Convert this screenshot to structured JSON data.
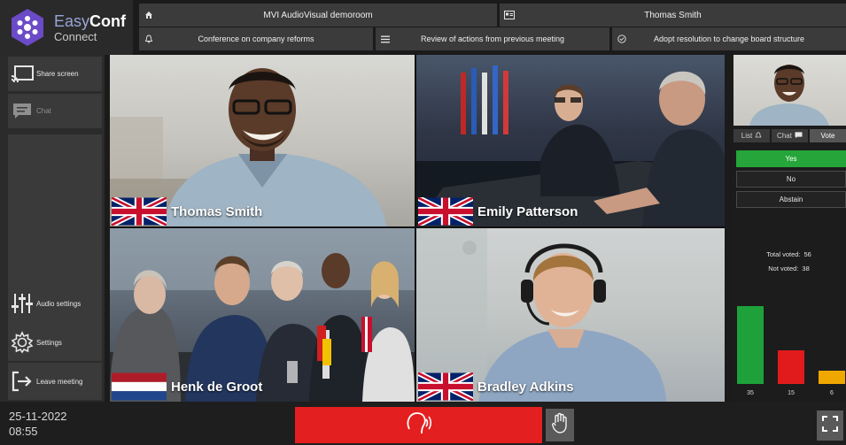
{
  "app": {
    "brand_easy": "Easy",
    "brand_conf": "Conf",
    "brand_sub": "Connect"
  },
  "header": {
    "room": "MVI AudioVisual demoroom",
    "user": "Thomas Smith",
    "agenda": [
      "Conference on company reforms",
      "Review of actions from previous meeting",
      "Adopt resolution to change board structure"
    ],
    "icons": [
      "home-icon",
      "id-card-icon",
      "bell-icon",
      "list-icon",
      "check-circle-icon"
    ]
  },
  "sidebar": {
    "share_screen": "Share screen",
    "chat": "Chat",
    "audio_settings": "Audio settings",
    "settings": "Settings",
    "leave_meeting": "Leave meeting"
  },
  "participants": [
    {
      "name": "Thomas Smith",
      "flag": "uk"
    },
    {
      "name": "Emily Patterson",
      "flag": "uk"
    },
    {
      "name": "Henk de Groot",
      "flag": "nl"
    },
    {
      "name": "Bradley Adkins",
      "flag": "uk"
    }
  ],
  "right_panel": {
    "tabs": [
      "List",
      "Chat",
      "Vote"
    ],
    "active_tab": "Vote",
    "vote_options": [
      "Yes",
      "No",
      "Abstain"
    ],
    "selected_option": "Yes",
    "total_voted_label": "Total voted:",
    "total_voted": "56",
    "not_voted_label": "Not voted:",
    "not_voted": "38",
    "results": [
      {
        "option": "Yes",
        "count": 35,
        "color": "#1ea13a"
      },
      {
        "option": "No",
        "count": 15,
        "color": "#e11b1b"
      },
      {
        "option": "Abstain",
        "count": 6,
        "color": "#f0a800"
      }
    ]
  },
  "footer": {
    "date": "25-11-2022",
    "time": "08:55"
  },
  "colors": {
    "speak_button": "#e41f1f",
    "brand_purple": "#5b3fa8"
  }
}
